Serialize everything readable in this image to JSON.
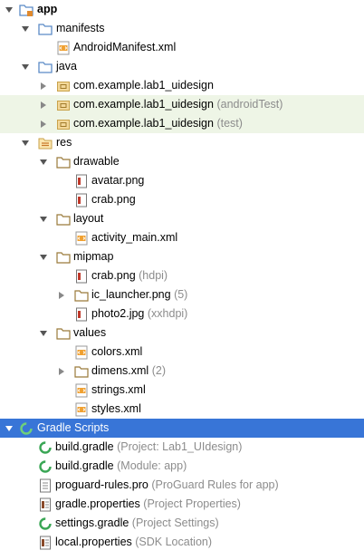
{
  "tree": {
    "app": {
      "label": "app"
    },
    "manifests": {
      "label": "manifests"
    },
    "android_manifest": {
      "label": "AndroidManifest.xml"
    },
    "java": {
      "label": "java"
    },
    "pkg_main": {
      "label": "com.example.lab1_uidesign"
    },
    "pkg_android_test": {
      "label": "com.example.lab1_uidesign",
      "hint": "(androidTest)"
    },
    "pkg_test": {
      "label": "com.example.lab1_uidesign",
      "hint": "(test)"
    },
    "res": {
      "label": "res"
    },
    "drawable": {
      "label": "drawable"
    },
    "avatar_png": {
      "label": "avatar.png"
    },
    "crab_png": {
      "label": "crab.png"
    },
    "layout": {
      "label": "layout"
    },
    "activity_main": {
      "label": "activity_main.xml"
    },
    "mipmap": {
      "label": "mipmap"
    },
    "mipmap_crab": {
      "label": "crab.png",
      "hint": "(hdpi)"
    },
    "ic_launcher": {
      "label": "ic_launcher.png",
      "hint": "(5)"
    },
    "photo2": {
      "label": "photo2.jpg",
      "hint": "(xxhdpi)"
    },
    "values": {
      "label": "values"
    },
    "colors_xml": {
      "label": "colors.xml"
    },
    "dimens_xml": {
      "label": "dimens.xml",
      "hint": "(2)"
    },
    "strings_xml": {
      "label": "strings.xml"
    },
    "styles_xml": {
      "label": "styles.xml"
    },
    "gradle_scripts": {
      "label": "Gradle Scripts"
    },
    "build_gradle_project": {
      "label": "build.gradle",
      "hint": "(Project: Lab1_UIdesign)"
    },
    "build_gradle_module": {
      "label": "build.gradle",
      "hint": "(Module: app)"
    },
    "proguard": {
      "label": "proguard-rules.pro",
      "hint": "(ProGuard Rules for app)"
    },
    "gradle_properties": {
      "label": "gradle.properties",
      "hint": "(Project Properties)"
    },
    "settings_gradle": {
      "label": "settings.gradle",
      "hint": "(Project Settings)"
    },
    "local_properties": {
      "label": "local.properties",
      "hint": "(SDK Location)"
    }
  },
  "colors": {
    "selection": "#3875d7",
    "test_source_bg": "#eef5e6",
    "hint_text": "#8c8c8c",
    "folder": "#6b9bd1",
    "res_folder": "#d9a440",
    "gradle": "#4caf50"
  }
}
